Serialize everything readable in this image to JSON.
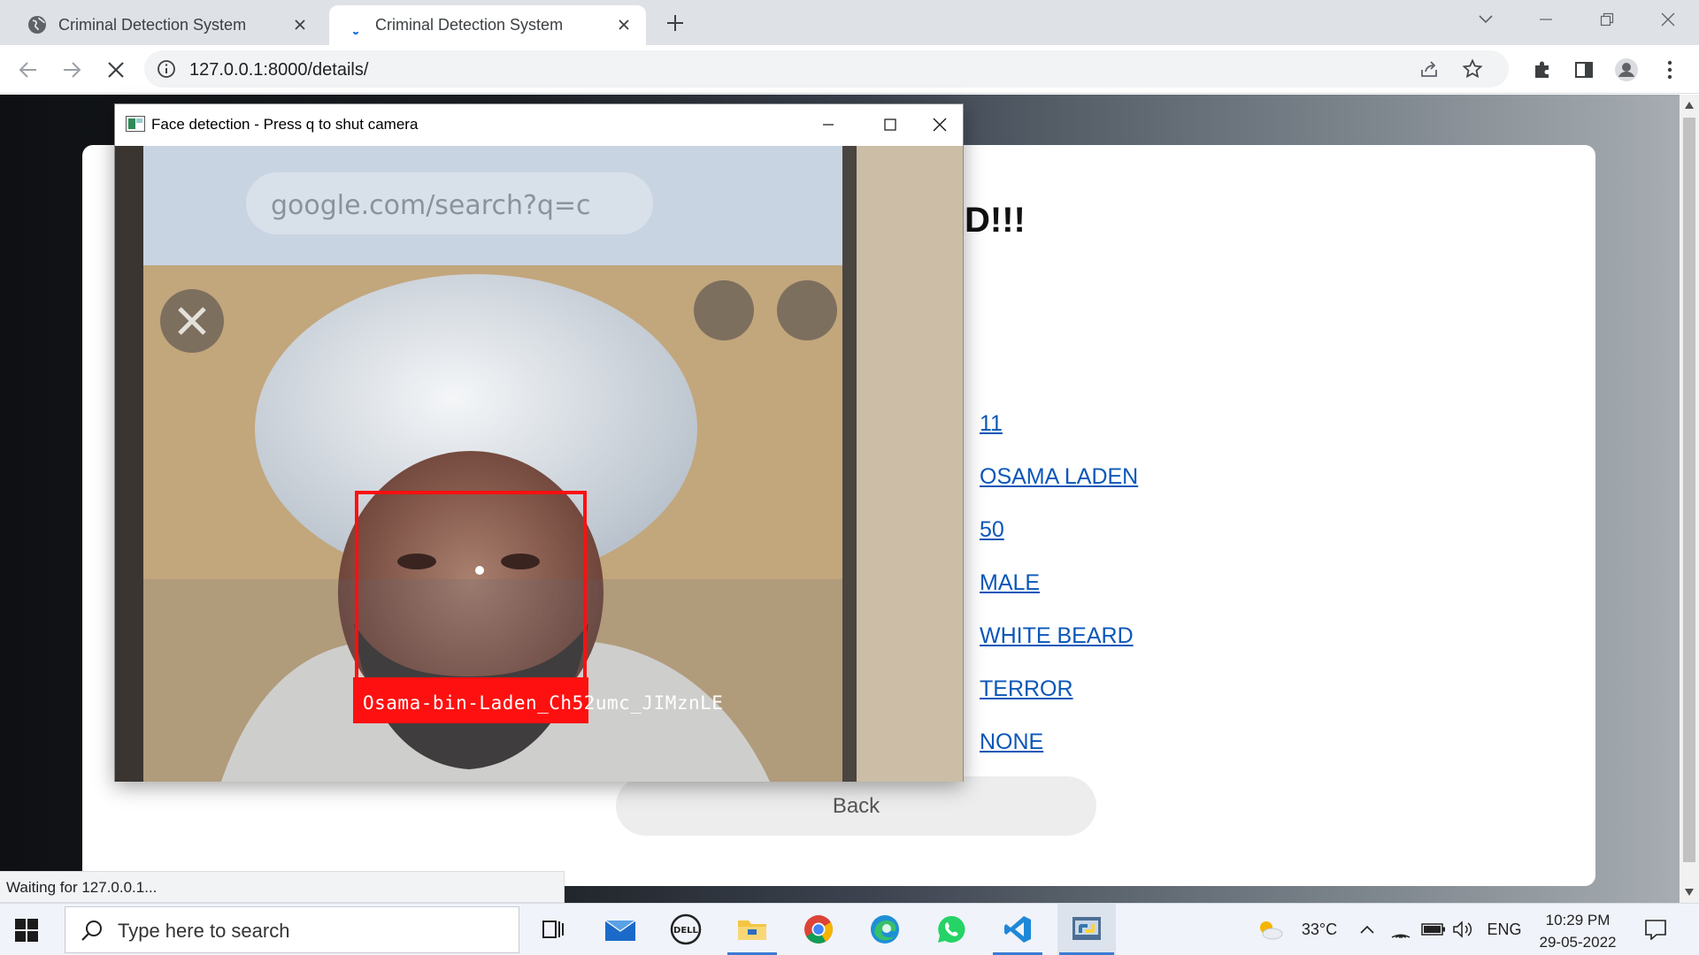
{
  "browser": {
    "tabs": [
      {
        "title": "Criminal Detection System",
        "active": false
      },
      {
        "title": "Criminal Detection System",
        "active": true
      }
    ],
    "url": "127.0.0.1:8000/details/",
    "status_text": "Waiting for 127.0.0.1..."
  },
  "page": {
    "heading": "D!!!",
    "details": [
      "11",
      "OSAMA LADEN",
      "50",
      "MALE",
      "WHITE BEARD",
      "TERROR",
      "NONE"
    ],
    "back_button": "Back"
  },
  "camera_window": {
    "title": "Face detection - Press q to shut camera",
    "detection_label": "Osama-bin-Laden_Ch52umc_JIMznLE",
    "phone_url": "google.com/search?q=c",
    "box_color": "#ff1010"
  },
  "taskbar": {
    "search_placeholder": "Type here to search",
    "weather": "33°C",
    "language": "ENG",
    "time": "10:29 PM",
    "date": "29-05-2022"
  },
  "colors": {
    "link": "#0b57b8",
    "tab_strip": "#dee1e6",
    "taskbar": "#f0f3f9"
  }
}
